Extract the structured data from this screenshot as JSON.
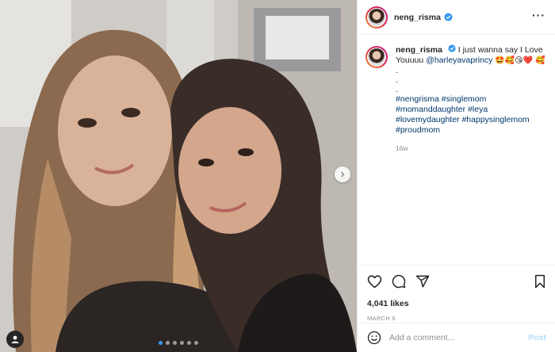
{
  "post": {
    "username": "neng_risma",
    "caption_text": "I just wanna say I Love Youuuu",
    "mention": "@harleyavaprincy",
    "caption_emojis": "🤩🥰😘❤️",
    "caption_emoji_line2": "🥰",
    "dot_lines": [
      ".",
      ".",
      "."
    ],
    "hashtags_line1": "#nengrisma #singlemom",
    "hashtags_line2": "#momanddaughter #leya",
    "hashtags_line3": "#lovemydaughter #happysinglemom",
    "hashtags_line4": "#proudmom",
    "time_ago": "16w",
    "likes": "4,041 likes",
    "date": "MARCH 6"
  },
  "comment": {
    "placeholder": "Add a comment...",
    "post_label": "Post"
  },
  "carousel": {
    "dot_count": 6,
    "active_index": 0
  },
  "colors": {
    "link": "#00376b",
    "verified": "#3897f0",
    "post_disabled": "#b2dffc",
    "meta": "#8e8e8e"
  },
  "icons": {
    "like": "heart-icon",
    "comment": "comment-bubble-icon",
    "share": "paper-plane-icon",
    "save": "bookmark-icon",
    "emoji": "smiley-icon",
    "more": "more-options-icon",
    "next": "chevron-right-icon",
    "tagged": "user-tag-icon"
  }
}
